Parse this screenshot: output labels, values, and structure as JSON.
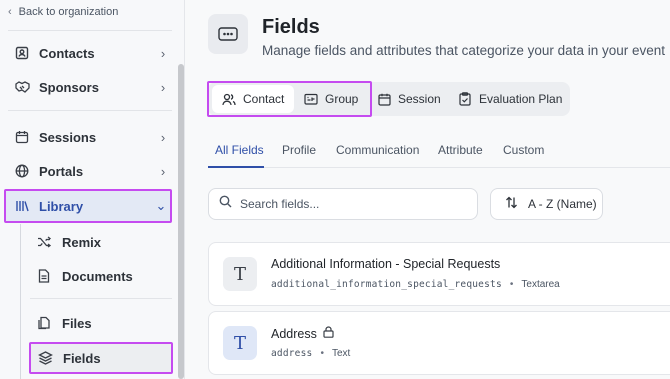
{
  "sidebar": {
    "back_label": "Back to organization",
    "items": [
      {
        "label": "Contacts",
        "icon": "contact-card-icon"
      },
      {
        "label": "Sponsors",
        "icon": "handshake-icon"
      },
      {
        "label": "Sessions",
        "icon": "calendar-icon"
      },
      {
        "label": "Portals",
        "icon": "globe-icon"
      },
      {
        "label": "Library",
        "icon": "library-icon"
      }
    ],
    "sub_items": [
      {
        "label": "Remix",
        "icon": "shuffle-icon"
      },
      {
        "label": "Documents",
        "icon": "document-icon"
      },
      {
        "label": "Files",
        "icon": "files-icon"
      },
      {
        "label": "Fields",
        "icon": "layers-icon"
      }
    ]
  },
  "header": {
    "title": "Fields",
    "subtitle": "Manage fields and attributes that categorize your data in your event"
  },
  "segments": [
    {
      "label": "Contact",
      "icon": "users-icon"
    },
    {
      "label": "Group",
      "icon": "group-folder-icon"
    },
    {
      "label": "Session",
      "icon": "calendar-icon"
    },
    {
      "label": "Evaluation Plan",
      "icon": "clipboard-check-icon"
    }
  ],
  "tabs": [
    "All Fields",
    "Profile",
    "Communication",
    "Attribute",
    "Custom"
  ],
  "search": {
    "placeholder": "Search fields..."
  },
  "sort": {
    "label": "A - Z (Name)"
  },
  "fields": [
    {
      "name": "Additional Information - Special Requests",
      "key": "additional_information_special_requests",
      "type": "Textarea",
      "icon_letter": "T",
      "locked": false
    },
    {
      "name": "Address",
      "key": "address",
      "type": "Text",
      "icon_letter": "T",
      "locked": true
    }
  ],
  "colors": {
    "accent": "#2f4fa8",
    "highlight": "#c54bf0",
    "active_bg": "#e3e9f5"
  }
}
